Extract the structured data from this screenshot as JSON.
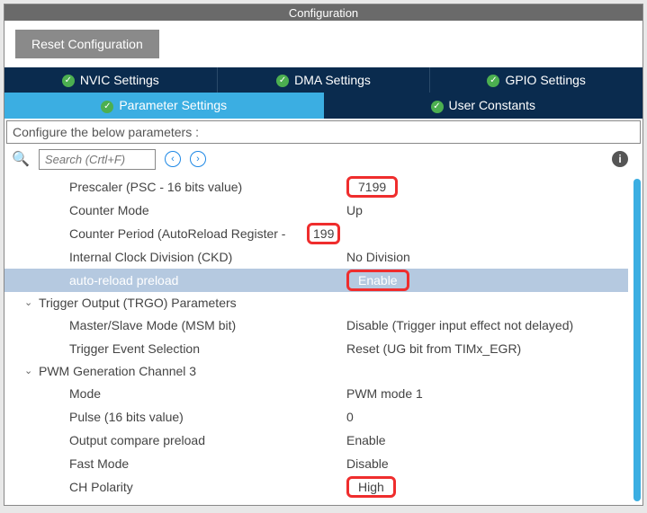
{
  "titlebar": "Configuration",
  "reset_btn": "Reset Configuration",
  "tabs1": {
    "nvic": "NVIC Settings",
    "dma": "DMA Settings",
    "gpio": "GPIO Settings"
  },
  "tabs2": {
    "param": "Parameter Settings",
    "user": "User Constants"
  },
  "cfg_label": "Configure the below parameters :",
  "search_placeholder": "Search (Crtl+F)",
  "rows": {
    "prescaler": {
      "label": "Prescaler (PSC - 16 bits value)",
      "value": "7199"
    },
    "counter_mode": {
      "label": "Counter Mode",
      "value": "Up"
    },
    "counter_period": {
      "label": "Counter Period (AutoReload Register - ",
      "value": "199"
    },
    "ckd": {
      "label": "Internal Clock Division (CKD)",
      "value": "No Division"
    },
    "arp": {
      "label": "auto-reload preload",
      "value": "Enable"
    }
  },
  "group_trgo": {
    "head": "Trigger Output (TRGO) Parameters",
    "msm": {
      "label": "Master/Slave Mode (MSM bit)",
      "value": "Disable (Trigger input effect not delayed)"
    },
    "tes": {
      "label": "Trigger Event Selection",
      "value": "Reset (UG bit from TIMx_EGR)"
    }
  },
  "group_pwm": {
    "head": "PWM Generation Channel 3",
    "mode": {
      "label": "Mode",
      "value": "PWM mode 1"
    },
    "pulse": {
      "label": "Pulse (16 bits value)",
      "value": "0"
    },
    "ocp": {
      "label": "Output compare preload",
      "value": "Enable"
    },
    "fast": {
      "label": "Fast Mode",
      "value": "Disable"
    },
    "chpol": {
      "label": "CH Polarity",
      "value": "High"
    }
  }
}
